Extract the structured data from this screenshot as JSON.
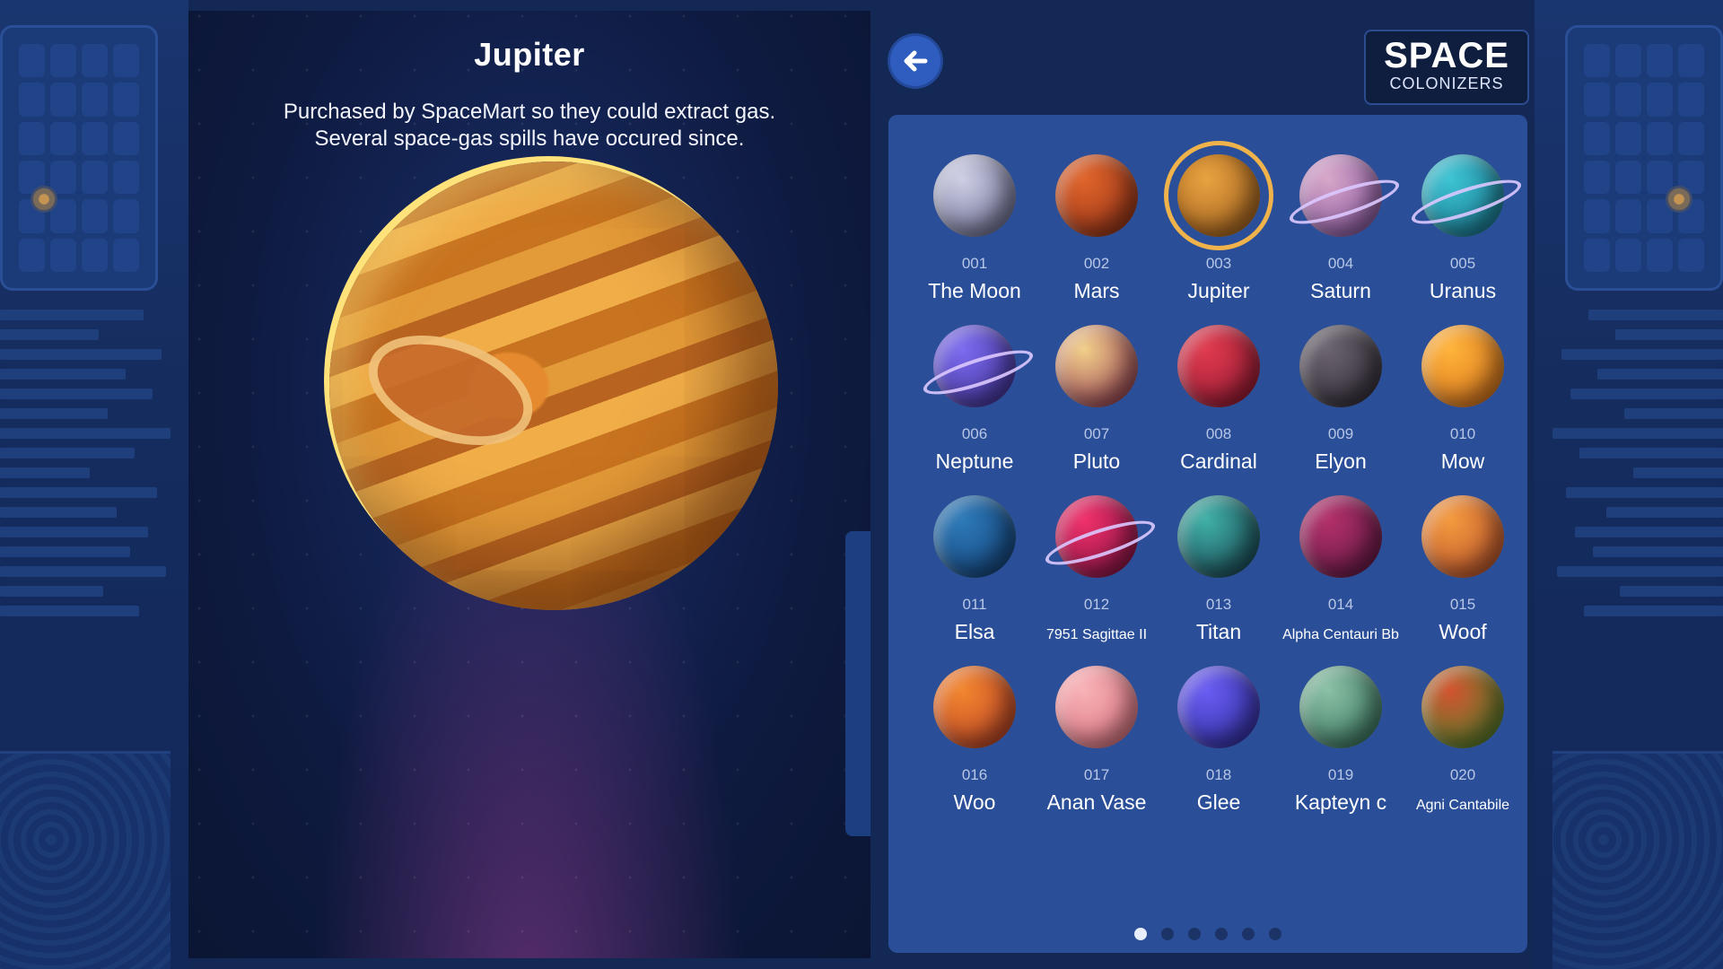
{
  "detail": {
    "title": "Jupiter",
    "description_line1": "Purchased by SpaceMart so they could extract gas.",
    "description_line2": "Several space-gas spills have occured since."
  },
  "header": {
    "back_icon": "arrow-left-icon",
    "logo_line1": "SPACE",
    "logo_line2": "COLONIZERS"
  },
  "planets": [
    {
      "num": "001",
      "name": "The Moon",
      "color": "#cfd0e6",
      "color2": "#5e5f86"
    },
    {
      "num": "002",
      "name": "Mars",
      "color": "#e0642a",
      "color2": "#8c2d16"
    },
    {
      "num": "003",
      "name": "Jupiter",
      "color": "#e7a240",
      "color2": "#9c5a1a",
      "selected": true
    },
    {
      "num": "004",
      "name": "Saturn",
      "color": "#d8a6c8",
      "color2": "#7b4b9a",
      "ring": true
    },
    {
      "num": "005",
      "name": "Uranus",
      "color": "#3cc4d4",
      "color2": "#156c86",
      "ring": true
    },
    {
      "num": "006",
      "name": "Neptune",
      "color": "#7c6cf0",
      "color2": "#3a2a8c",
      "ring": true
    },
    {
      "num": "007",
      "name": "Pluto",
      "color": "#f2d08a",
      "color2": "#8a2a4a"
    },
    {
      "num": "008",
      "name": "Cardinal",
      "color": "#e03a4e",
      "color2": "#8c1630"
    },
    {
      "num": "009",
      "name": "Elyon",
      "color": "#6b6470",
      "color2": "#2b2530"
    },
    {
      "num": "010",
      "name": "Mow",
      "color": "#ffb43a",
      "color2": "#d06a18"
    },
    {
      "num": "011",
      "name": "Elsa",
      "color": "#2d7ab8",
      "color2": "#113d74"
    },
    {
      "num": "012",
      "name": "7951 Sagittae II",
      "color": "#f0306a",
      "color2": "#7a1040",
      "ring": true,
      "small": true
    },
    {
      "num": "013",
      "name": "Titan",
      "color": "#3fb0a6",
      "color2": "#153a4a"
    },
    {
      "num": "014",
      "name": "Alpha Centauri Bb",
      "color": "#b2306a",
      "color2": "#5a1640",
      "small": true
    },
    {
      "num": "015",
      "name": "Woof",
      "color": "#f39a3e",
      "color2": "#b54a2a"
    },
    {
      "num": "016",
      "name": "Woo",
      "color": "#f2862e",
      "color2": "#b43a26"
    },
    {
      "num": "017",
      "name": "Anan Vase",
      "color": "#f7b2b6",
      "color2": "#d86a7a"
    },
    {
      "num": "018",
      "name": "Glee",
      "color": "#6a5cf2",
      "color2": "#2a2a9a"
    },
    {
      "num": "019",
      "name": "Kapteyn c",
      "color": "#8ac0a4",
      "color2": "#2e6a56"
    },
    {
      "num": "020",
      "name": "Agni Cantabile",
      "color": "#d3532e",
      "color2": "#3c8a2c",
      "small": true
    }
  ],
  "pagination": {
    "pages": 6,
    "current": 1
  }
}
